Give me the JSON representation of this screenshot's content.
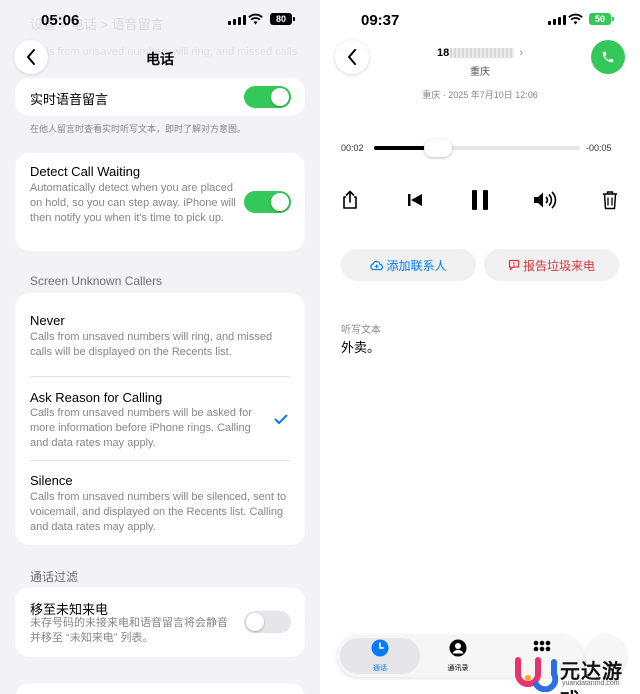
{
  "left": {
    "status": {
      "time": "05:06",
      "battery": "80",
      "ghost_text": "设置 > 电话 > 语音留言"
    },
    "nav": {
      "title": "电话"
    },
    "live_voicemail": {
      "label": "实时语音留言",
      "enabled": true,
      "footer": "在他人留言时查看实时听写文本，即时了解对方意图。"
    },
    "call_waiting": {
      "title": "Detect Call Waiting",
      "description": "Automatically detect when you are placed on hold, so you can step away. iPhone will then notify you when it's time to pick up.",
      "enabled": true
    },
    "screen_unknown": {
      "header": "Screen Unknown Callers",
      "options": [
        {
          "title": "Never",
          "description": "Calls from unsaved numbers will ring, and missed calls will be displayed on the Recents list.",
          "selected": false
        },
        {
          "title": "Ask Reason for Calling",
          "description": "Calls from unsaved numbers will be asked for more information before iPhone rings. Calling and data rates may apply.",
          "selected": true
        },
        {
          "title": "Silence",
          "description": "Calls from unsaved numbers will be silenced, sent to voicemail, and displayed on the Recents list. Calling and data rates may apply.",
          "selected": false
        }
      ]
    },
    "filter": {
      "header": "通话过滤",
      "title": "移至未知来电",
      "description": "未存号码的未接来电和语音留言将会静音并移至 “未知来电” 列表。",
      "enabled": false
    }
  },
  "right": {
    "status": {
      "time": "09:37",
      "battery": "50"
    },
    "caller": {
      "number_prefix": "18",
      "chevron": "›",
      "location": "重庆"
    },
    "meta": "重庆 · 2025 年7月10日 12:06",
    "playback": {
      "elapsed": "00:02",
      "remaining": "-00:05",
      "progress": 0.31
    },
    "controls": [
      "share-icon",
      "rewind-icon",
      "pause-icon",
      "speaker-icon",
      "trash-icon"
    ],
    "actions": {
      "add_contact": "添加联系人",
      "report_spam": "报告垃圾来电"
    },
    "transcript": {
      "label": "听写文本",
      "text": "外卖。"
    },
    "tabs": [
      {
        "label": "通话",
        "active": true,
        "icon": "clock-icon"
      },
      {
        "label": "通讯录",
        "active": false,
        "icon": "person-icon"
      },
      {
        "label": "",
        "active": false,
        "icon": "keypad-icon"
      }
    ],
    "watermark": {
      "name": "元达游戏",
      "url": "yuandatanmd.com"
    }
  },
  "colors": {
    "green": "#34c759",
    "blue": "#007aff",
    "red": "#d9363e"
  }
}
